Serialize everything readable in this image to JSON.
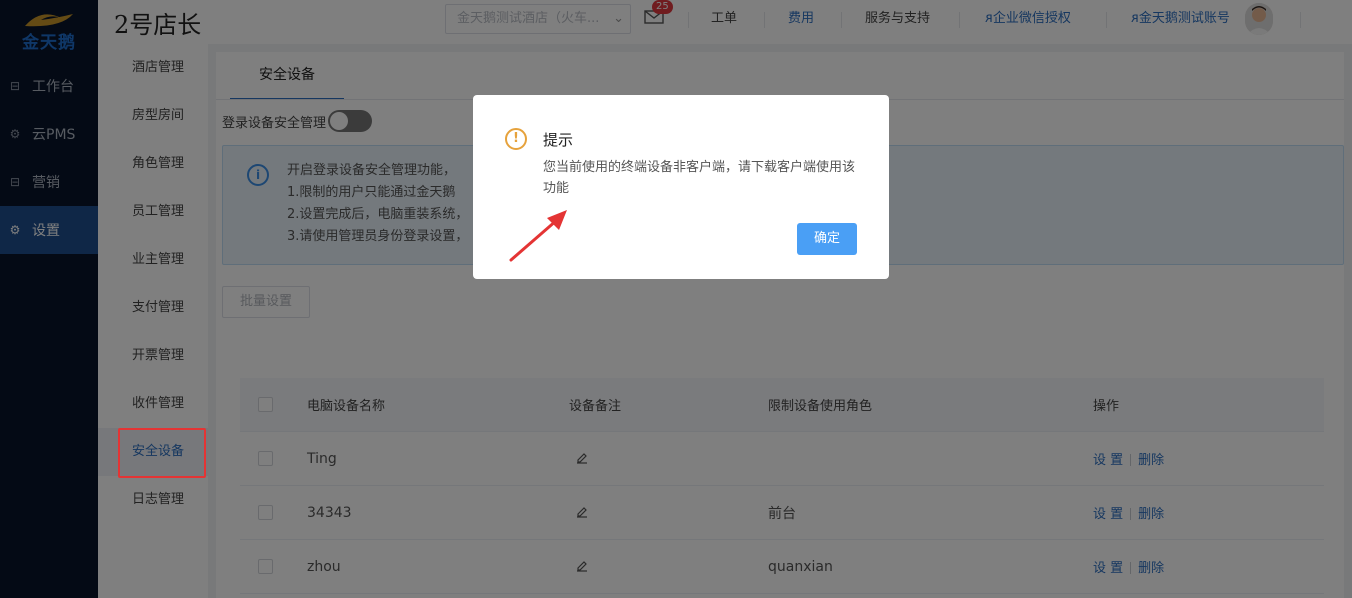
{
  "sidebar": {
    "logo_text": "金天鹅",
    "items": [
      {
        "label": "工作台",
        "icon": "workbench-icon"
      },
      {
        "label": "云PMS",
        "icon": "gear-icon"
      },
      {
        "label": "营销",
        "icon": "marketing-icon"
      },
      {
        "label": "设置",
        "icon": "gear-icon",
        "active": true
      }
    ]
  },
  "header": {
    "brand": "2号店长",
    "hotel_select": "金天鹅测试酒店（火车...",
    "mail_badge": "25",
    "links": [
      "工单",
      "费用",
      "服务与支持",
      "企业微信授权",
      "金天鹅测试账号"
    ]
  },
  "submenu": {
    "items": [
      "酒店管理",
      "房型房间",
      "角色管理",
      "员工管理",
      "业主管理",
      "支付管理",
      "开票管理",
      "收件管理",
      "安全设备",
      "日志管理"
    ],
    "active": "安全设备"
  },
  "main": {
    "tab": "安全设备",
    "toggle_label": "登录设备安全管理",
    "toggle_on": false,
    "info_lines": [
      "开启登录设备安全管理功能，",
      "1.限制的用户只能通过金天鹅",
      "2.设置完成后，电脑重装系统，",
      "3.请使用管理员身份登录设置，"
    ],
    "batch_button": "批量设置"
  },
  "table": {
    "columns": [
      "电脑设备名称",
      "设备备注",
      "限制设备使用角色",
      "操作"
    ],
    "rows": [
      {
        "name": "Ting",
        "role": ""
      },
      {
        "name": "34343",
        "role": "前台"
      },
      {
        "name": "zhou",
        "role": "quanxian"
      }
    ],
    "op_set": "设 置",
    "op_delete": "删除"
  },
  "modal": {
    "title": "提示",
    "message": "您当前使用的终端设备非客户端，请下载客户端使用该功能",
    "ok": "确定"
  },
  "colors": {
    "accent": "#2d6fc0",
    "sidebar_bg": "#08142a",
    "warning": "#e6a23c",
    "annotation_red": "#e43434"
  }
}
